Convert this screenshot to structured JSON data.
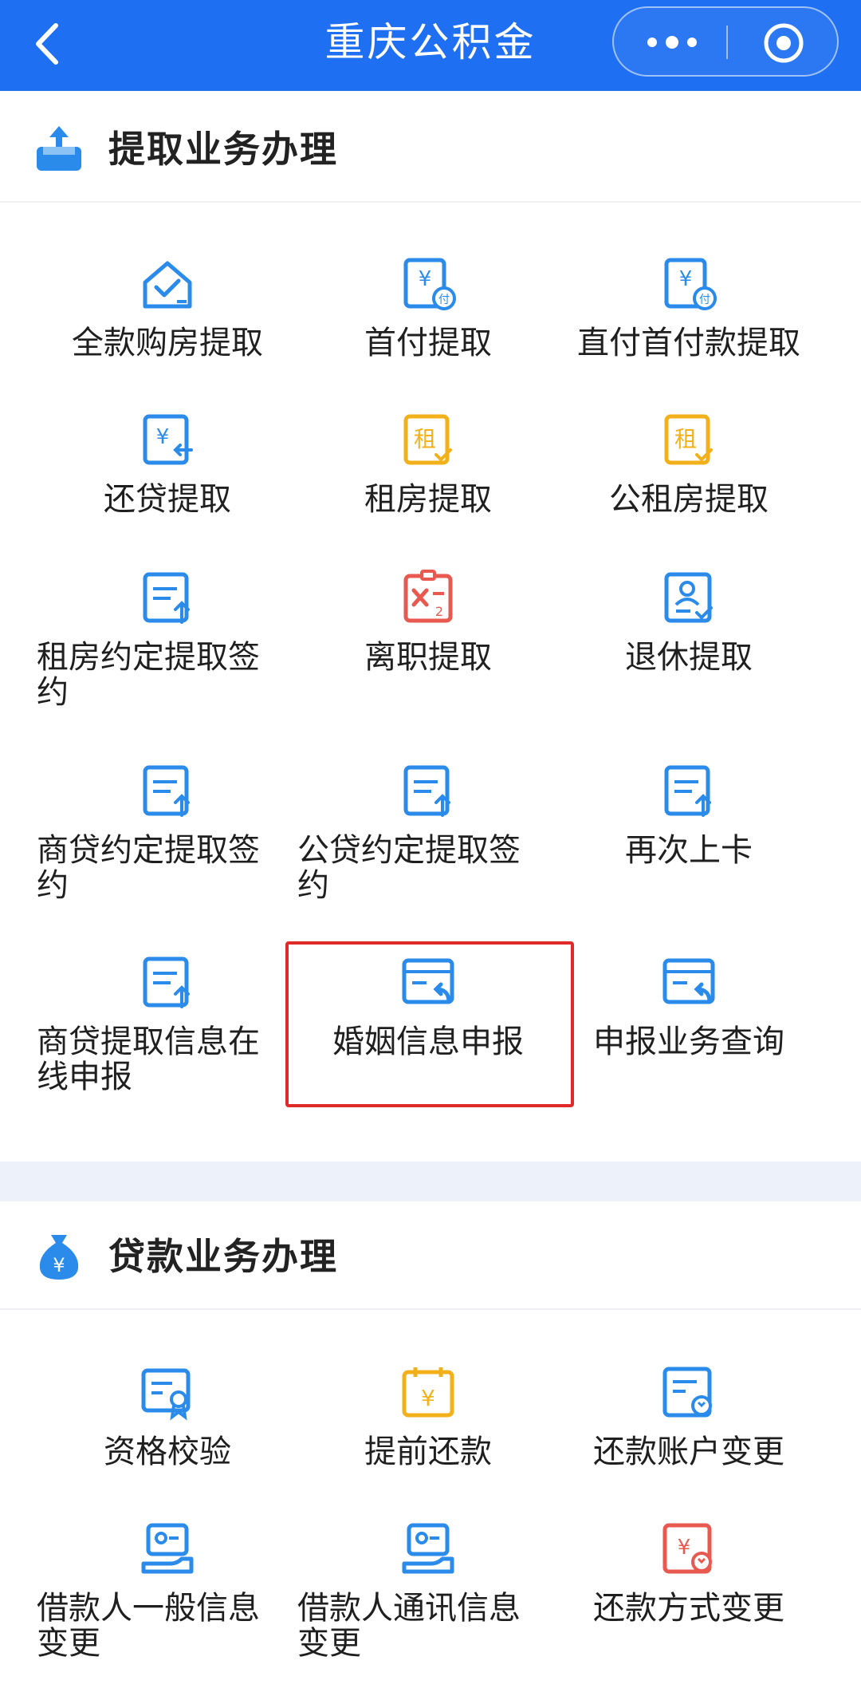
{
  "header": {
    "title": "重庆公积金",
    "colors": {
      "bar": "#1f6ff2",
      "blue_icon": "#2a8bea",
      "yellow_icon": "#f2b11a",
      "red_icon": "#e85a4f"
    }
  },
  "withdraw_section": {
    "title": "提取业务办理",
    "icon": "withdraw-tray-icon",
    "items": [
      {
        "label": "全款购房提取",
        "icon": "house-check-icon"
      },
      {
        "label": "首付提取",
        "icon": "yuan-pay-doc-icon"
      },
      {
        "label": "直付首付款提取",
        "icon": "yuan-pay-doc-icon"
      },
      {
        "label": "还贷提取",
        "icon": "yuan-return-doc-icon"
      },
      {
        "label": "租房提取",
        "icon": "rent-doc-icon"
      },
      {
        "label": "公租房提取",
        "icon": "rent-doc-icon"
      },
      {
        "label": "租房约定提取签约",
        "icon": "doc-upload-icon"
      },
      {
        "label": "离职提取",
        "icon": "resign-doc-icon"
      },
      {
        "label": "退休提取",
        "icon": "person-doc-icon"
      },
      {
        "label": "商贷约定提取签约",
        "icon": "doc-upload-icon"
      },
      {
        "label": "公贷约定提取签约",
        "icon": "doc-upload-icon"
      },
      {
        "label": "再次上卡",
        "icon": "doc-upload-icon"
      },
      {
        "label": "商贷提取信息在线申报",
        "icon": "doc-upload-icon"
      },
      {
        "label": "婚姻信息申报",
        "icon": "card-return-icon"
      },
      {
        "label": "申报业务查询",
        "icon": "card-return-icon"
      }
    ]
  },
  "loan_section": {
    "title": "贷款业务办理",
    "icon": "money-bag-icon",
    "items": [
      {
        "label": "资格校验",
        "icon": "cert-check-icon"
      },
      {
        "label": "提前还款",
        "icon": "calendar-yuan-icon"
      },
      {
        "label": "还款账户变更",
        "icon": "doc-refresh-icon"
      },
      {
        "label": "借款人一般信息变更",
        "icon": "hand-card-icon"
      },
      {
        "label": "借款人通讯信息变更",
        "icon": "hand-card-icon"
      },
      {
        "label": "还款方式变更",
        "icon": "yuan-refresh-icon"
      }
    ]
  }
}
